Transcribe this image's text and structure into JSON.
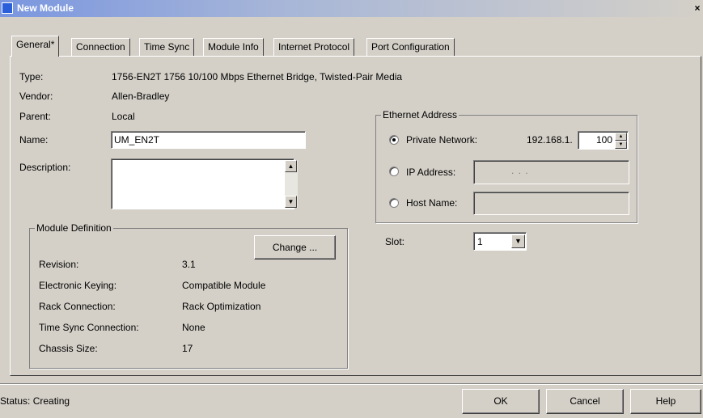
{
  "window": {
    "title": "New Module",
    "close_glyph": "×"
  },
  "tabs": [
    {
      "label": "General*"
    },
    {
      "label": "Connection"
    },
    {
      "label": "Time Sync"
    },
    {
      "label": "Module Info"
    },
    {
      "label": "Internet Protocol"
    },
    {
      "label": "Port Configuration"
    }
  ],
  "general": {
    "type_label": "Type:",
    "type_value": "1756-EN2T 1756 10/100 Mbps Ethernet Bridge, Twisted-Pair Media",
    "vendor_label": "Vendor:",
    "vendor_value": "Allen-Bradley",
    "parent_label": "Parent:",
    "parent_value": "Local",
    "name_label": "Name:",
    "name_value": "UM_EN2T",
    "description_label": "Description:",
    "description_value": ""
  },
  "module_definition": {
    "title": "Module Definition",
    "change_button": "Change ...",
    "revision_label": "Revision:",
    "revision_value": "3.1",
    "keying_label": "Electronic Keying:",
    "keying_value": "Compatible Module",
    "rack_label": "Rack Connection:",
    "rack_value": "Rack Optimization",
    "timesync_label": "Time Sync Connection:",
    "timesync_value": "None",
    "chassis_label": "Chassis Size:",
    "chassis_value": "17"
  },
  "ethernet": {
    "title": "Ethernet Address",
    "private_label": "Private Network:",
    "private_prefix": "192.168.1.",
    "private_octet": "100",
    "ip_label": "IP Address:",
    "ip_dots": ".      .      .",
    "host_label": "Host Name:",
    "selected": "private"
  },
  "slot": {
    "label": "Slot:",
    "value": "1"
  },
  "footer": {
    "status": "Status:  Creating",
    "ok": "OK",
    "cancel": "Cancel",
    "help": "Help"
  }
}
